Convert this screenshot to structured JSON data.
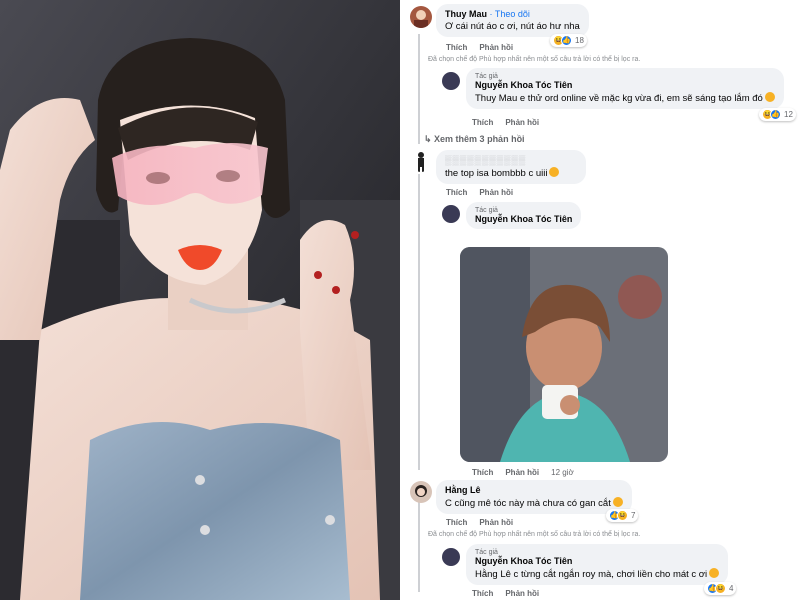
{
  "comments": [
    {
      "author": "Thuy Mau",
      "follow_label": "· Theo dõi",
      "text": "Ơ cái nút áo c ơi, nút áo hư nha",
      "actions": {
        "like": "Thích",
        "reply": "Phản hồi"
      },
      "reaction_count": "18",
      "notice": "Đã chọn chế độ Phù hợp nhất nên một số câu trả lời có thể bị lọc ra."
    },
    {
      "author_tag": "Tác giả",
      "author": "Nguyễn Khoa Tóc Tiên",
      "text": "Thuy Mau e thử ord online về mặc kg vừa đi, em sẽ sáng tạo lắm đó",
      "actions": {
        "like": "Thích",
        "reply": "Phản hồi"
      },
      "reaction_count": "12",
      "more_replies": "Xem thêm 3 phản hồi"
    },
    {
      "author": "",
      "text": "the top isa bombbb c uiii",
      "actions": {
        "like": "Thích",
        "reply": "Phản hồi"
      }
    },
    {
      "author_tag": "Tác giả",
      "author": "Nguyễn Khoa Tóc Tiên",
      "actions": {
        "like": "Thích",
        "reply": "Phản hồi",
        "time": "12 giờ"
      }
    },
    {
      "author": "Hằng Lê",
      "text": "C cũng mê tóc này mà chưa có gan cắt",
      "actions": {
        "like": "Thích",
        "reply": "Phản hồi"
      },
      "reaction_count": "7",
      "notice": "Đã chọn chế độ Phù hợp nhất nên một số câu trả lời có thể bị lọc ra."
    },
    {
      "author_tag": "Tác giả",
      "author": "Nguyễn Khoa Tóc Tiên",
      "text": "Hằng Lê c từng cắt ngắn roy mà, chơi liền cho mát c ơi",
      "actions": {
        "like": "Thích",
        "reply": "Phản hồi"
      },
      "reaction_count": "4"
    }
  ],
  "colors": {
    "bubble": "#f0f2f5",
    "link_blue": "#1877f2",
    "secondary_text": "#65676b"
  }
}
